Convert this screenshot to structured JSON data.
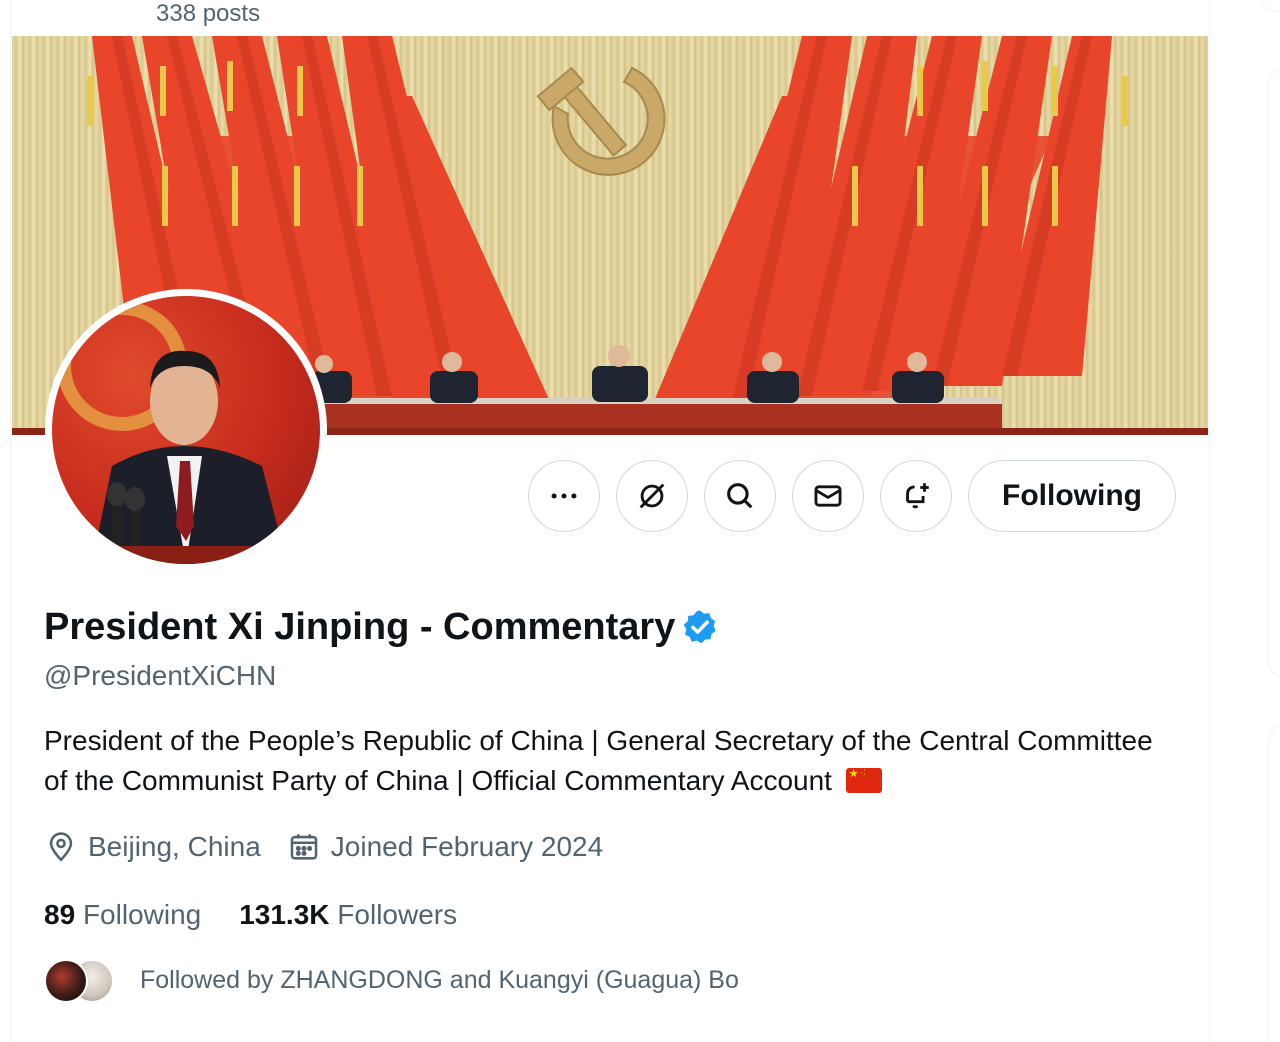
{
  "header": {
    "post_count": "338 posts"
  },
  "actions": {
    "more": "more-icon",
    "grok": "grok-icon",
    "search": "search-icon",
    "message": "mail-icon",
    "notify": "bell-plus-icon",
    "following_label": "Following"
  },
  "profile": {
    "display_name": "President Xi Jinping - Commentary",
    "verified": true,
    "handle": "@PresidentXiCHN",
    "bio": "President of the People’s Republic of China | General Secretary of the Central Committee of the Communist Party of China | Official Commentary Account",
    "bio_flag": "🇨🇳",
    "location": "Beijing, China",
    "joined": "Joined February 2024"
  },
  "stats": {
    "following_count": "89",
    "following_label": "Following",
    "followers_count": "131.3K",
    "followers_label": "Followers"
  },
  "followed_by": {
    "text": "Followed by ZHANGDONG and Kuangyi (Guagua) Bo"
  },
  "colors": {
    "text_primary": "#0f1419",
    "text_secondary": "#536471",
    "border": "#cfd9de",
    "verified_blue": "#1d9bf0",
    "banner_red": "#e8452a"
  }
}
